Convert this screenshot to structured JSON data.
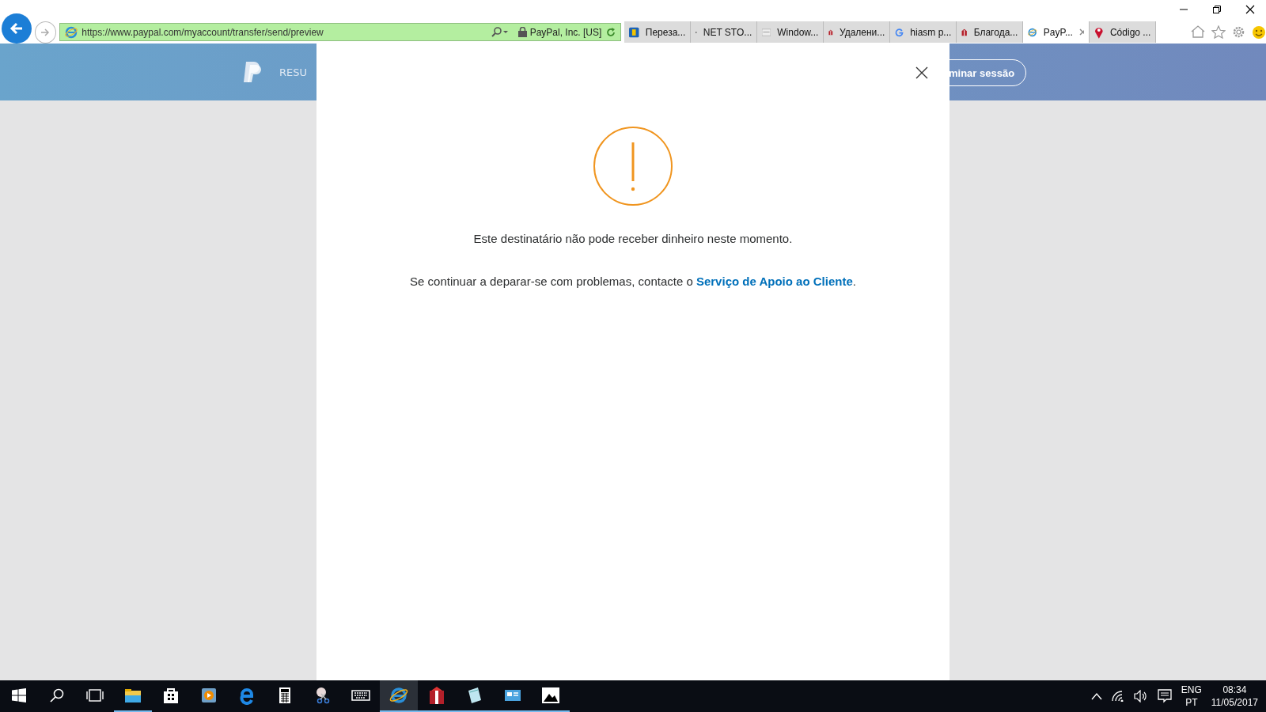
{
  "browser": {
    "url": "https://www.paypal.com/myaccount/transfer/send/preview",
    "site_identity": "PayPal, Inc. [US]",
    "tabs": [
      {
        "label": "Переза...",
        "kind": "r",
        "selected": false
      },
      {
        "label": "NET STO...",
        "kind": "cmd",
        "selected": false
      },
      {
        "label": "Window...",
        "kind": "page",
        "selected": false
      },
      {
        "label": "Удалени...",
        "kind": "gift",
        "selected": false
      },
      {
        "label": "hiasm p...",
        "kind": "g",
        "selected": false
      },
      {
        "label": "Благода...",
        "kind": "gift",
        "selected": false
      },
      {
        "label": "PayP...",
        "kind": "ie",
        "selected": true
      },
      {
        "label": "Código ...",
        "kind": "pin",
        "selected": false
      }
    ]
  },
  "header": {
    "nav_item": "RESU",
    "logout_button": "minar sessão"
  },
  "dialog": {
    "message": "Este destinatário não pode receber dinheiro neste momento.",
    "help_text": "Se continuar a deparar-se com problemas, contacte o ",
    "help_link": "Serviço de Apoio ao Cliente",
    "help_end": "."
  },
  "taskbar": {
    "apps": [
      {
        "kind": "folder",
        "running": true,
        "selected": false
      },
      {
        "kind": "store",
        "running": false,
        "selected": false
      },
      {
        "kind": "media",
        "running": false,
        "selected": false
      },
      {
        "kind": "edge",
        "running": false,
        "selected": false
      },
      {
        "kind": "calculator",
        "running": false,
        "selected": false
      },
      {
        "kind": "scissors",
        "running": false,
        "selected": false
      },
      {
        "kind": "keyboard",
        "running": false,
        "selected": false
      },
      {
        "kind": "ie",
        "running": true,
        "selected": true
      },
      {
        "kind": "gift",
        "running": true,
        "selected": false
      },
      {
        "kind": "notepad",
        "running": true,
        "selected": false
      },
      {
        "kind": "monitor",
        "running": true,
        "selected": false
      },
      {
        "kind": "photos",
        "running": true,
        "selected": false
      }
    ],
    "language": "ENG",
    "layout": "PT",
    "time": "08:34",
    "date": "11/05/2017"
  }
}
